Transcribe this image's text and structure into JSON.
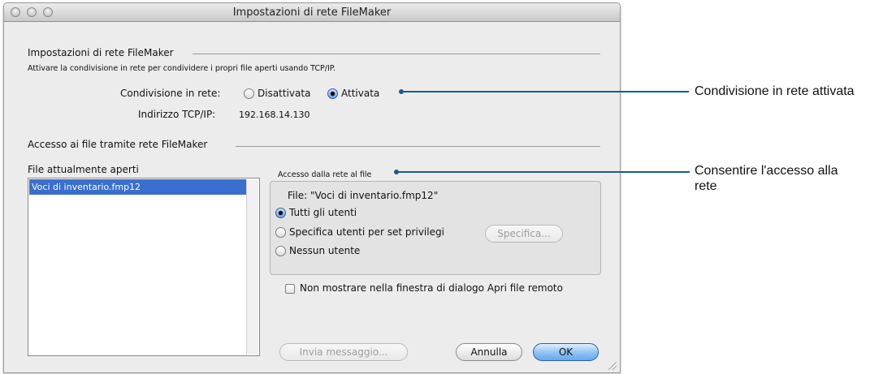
{
  "window": {
    "title": "Impostazioni di rete FileMaker"
  },
  "network": {
    "section_title": "Impostazioni di rete FileMaker",
    "description": "Attivare la condivisione in rete per condividere i propri file aperti usando TCP/IP.",
    "sharing_label": "Condivisione in rete:",
    "option_off": "Disattivata",
    "option_on": "Attivata",
    "selected": "Attivata",
    "ip_label": "Indirizzo TCP/IP:",
    "ip_value": "192.168.14.130"
  },
  "file_access": {
    "section_title": "Accesso ai file tramite rete FileMaker",
    "open_files_label": "File attualmente aperti",
    "open_files": [
      "Voci di inventario.fmp12"
    ],
    "access_group_label": "Accesso dalla rete al file",
    "file_line": "File: \"Voci di inventario.fmp12\"",
    "option_all": "Tutti gli utenti",
    "option_privileges": "Specifica utenti per set privilegi",
    "specify_button": "Specifica...",
    "option_none": "Nessun utente",
    "selected": "Tutti gli utenti",
    "hide_checkbox_label": "Non mostrare nella finestra di dialogo Apri file remoto",
    "hide_checkbox_checked": false
  },
  "buttons": {
    "send_message": "Invia messaggio...",
    "cancel": "Annulla",
    "ok": "OK"
  },
  "callouts": {
    "sharing": "Condivisione in rete attivata",
    "access_line1": "Consentire l'accesso alla",
    "access_line2": "rete"
  },
  "colors": {
    "callout_line": "#1a5a8f",
    "selection": "#3a6fd0",
    "window_bg": "#ececec"
  }
}
